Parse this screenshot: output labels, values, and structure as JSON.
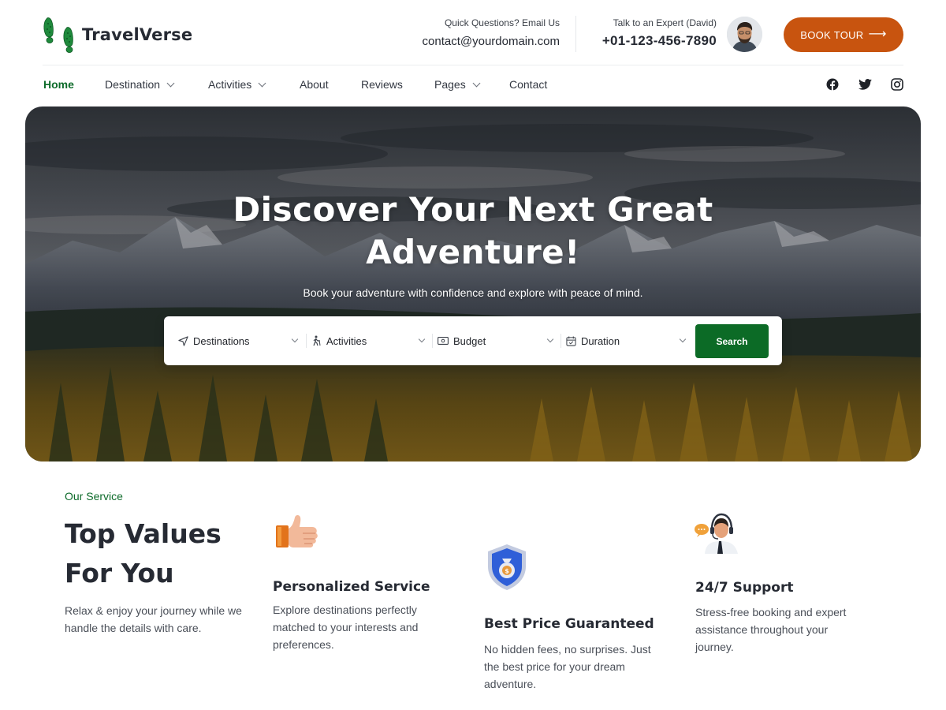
{
  "brand": {
    "name": "TravelVerse",
    "logo_icon": "footprints-icon"
  },
  "header": {
    "email_label": "Quick Questions? Email Us",
    "email_value": "contact@yourdomain.com",
    "phone_label": "Talk to an Expert (David)",
    "phone_value": "+01-123-456-7890",
    "cta_label": "BOOK TOUR",
    "cta_icon": "arrow-right-icon"
  },
  "nav": {
    "items": [
      {
        "label": "Home",
        "active": true,
        "dropdown": false
      },
      {
        "label": "Destination",
        "active": false,
        "dropdown": true
      },
      {
        "label": "Activities",
        "active": false,
        "dropdown": true
      },
      {
        "label": "About",
        "active": false,
        "dropdown": false
      },
      {
        "label": "Reviews",
        "active": false,
        "dropdown": false
      },
      {
        "label": "Pages",
        "active": false,
        "dropdown": true
      },
      {
        "label": "Contact",
        "active": false,
        "dropdown": false
      }
    ],
    "social": [
      "facebook-icon",
      "twitter-icon",
      "instagram-icon"
    ]
  },
  "hero": {
    "title_line1": "Discover Your Next Great",
    "title_line2": "Adventure!",
    "subtitle": "Book your adventure with confidence and explore with peace of mind."
  },
  "search": {
    "fields": [
      {
        "label": "Destinations",
        "icon": "navigation-icon"
      },
      {
        "label": "Activities",
        "icon": "hiking-icon"
      },
      {
        "label": "Budget",
        "icon": "money-icon"
      },
      {
        "label": "Duration",
        "icon": "calendar-icon"
      }
    ],
    "button_label": "Search"
  },
  "services": {
    "eyebrow": "Our Service",
    "title_line1": "Top Values",
    "title_line2": "For You",
    "description": "Relax & enjoy your journey while we handle the details with care.",
    "cards": [
      {
        "icon": "thumbs-up-icon",
        "title": "Personalized Service",
        "text": "Explore destinations perfectly matched to your interests and preferences."
      },
      {
        "icon": "money-shield-icon",
        "title": "Best Price Guaranteed",
        "text": "No hidden fees, no surprises. Just the best price for your dream adventure."
      },
      {
        "icon": "support-agent-icon",
        "title": "24/7 Support",
        "text": "Stress-free booking and expert assistance throughout your journey."
      }
    ]
  },
  "colors": {
    "brand_green": "#0d6b2a",
    "cta_orange": "#c8540f",
    "text_dark": "#262a33"
  }
}
